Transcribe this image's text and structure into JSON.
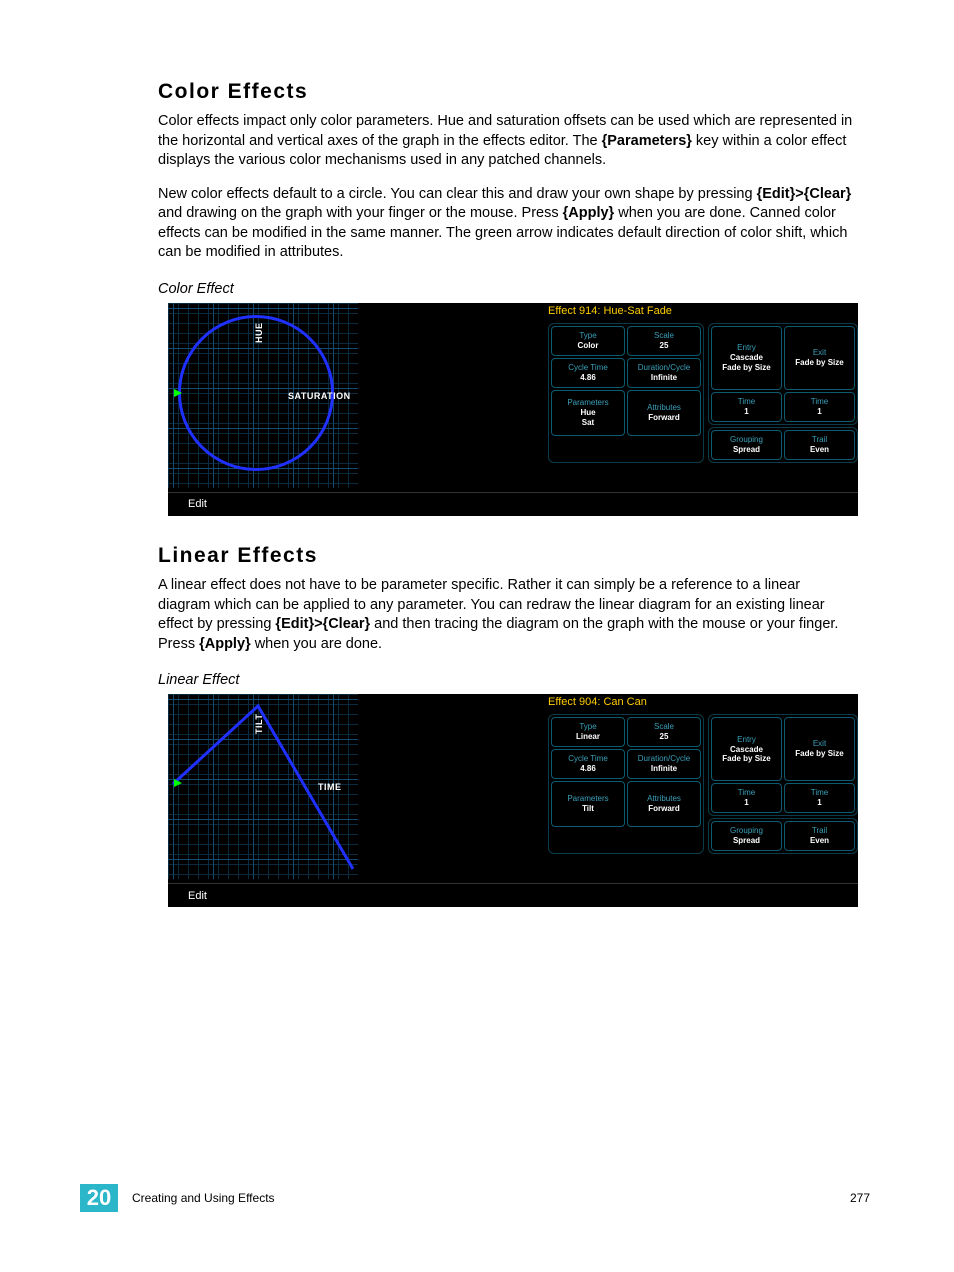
{
  "section1": {
    "heading": "Color Effects",
    "p1_a": "Color effects impact only color parameters. Hue and saturation offsets can be used which are represented in the horizontal and vertical axes of the graph in the effects editor. The ",
    "p1_b": "{Parameters}",
    "p1_c": " key within a color effect displays the various color mechanisms used in any patched channels.",
    "p2_a": "New color effects default to a circle. You can clear this and draw your own shape by pressing ",
    "p2_b": "{Edit}>{Clear}",
    "p2_c": " and drawing on the graph with your finger or the mouse. Press ",
    "p2_d": "{Apply}",
    "p2_e": " when you are done. Canned color effects can be modified in the same manner. The green arrow indicates default direction of color shift, which can be modified in attributes.",
    "caption": "Color Effect"
  },
  "panel1": {
    "title": "Effect 914: Hue-Sat Fade",
    "y_axis": "HUE",
    "x_axis": "SATURATION",
    "edit": "Edit",
    "left": {
      "type": {
        "label": "Type",
        "value": "Color"
      },
      "scale": {
        "label": "Scale",
        "value": "25"
      },
      "cycle": {
        "label": "Cycle Time",
        "value": "4.86"
      },
      "duration": {
        "label": "Duration/Cycle",
        "value": "Infinite"
      },
      "params": {
        "label": "Parameters",
        "value": "Hue\nSat"
      },
      "attrs": {
        "label": "Attributes",
        "value": "Forward"
      }
    },
    "right": {
      "entry": {
        "label": "Entry",
        "value": "Cascade\nFade by Size"
      },
      "exit": {
        "label": "Exit",
        "value": "Fade by Size"
      },
      "time1": {
        "label": "Time",
        "value": "1"
      },
      "time2": {
        "label": "Time",
        "value": "1"
      },
      "grouping": {
        "label": "Grouping",
        "value": "Spread"
      },
      "trail": {
        "label": "Trail",
        "value": "Even"
      }
    }
  },
  "section2": {
    "heading": "Linear Effects",
    "p1_a": "A linear effect does not have to be parameter specific. Rather it can simply be a reference to a linear diagram which can be applied to any parameter. You can redraw the linear diagram for an existing linear effect by pressing ",
    "p1_b": "{Edit}>{Clear}",
    "p1_c": " and then tracing the diagram on the graph with the mouse or your finger. Press ",
    "p1_d": "{Apply}",
    "p1_e": " when you are done.",
    "caption": "Linear Effect"
  },
  "panel2": {
    "title": "Effect 904: Can Can",
    "y_axis": "TILT",
    "x_axis": "TIME",
    "edit": "Edit",
    "left": {
      "type": {
        "label": "Type",
        "value": "Linear"
      },
      "scale": {
        "label": "Scale",
        "value": "25"
      },
      "cycle": {
        "label": "Cycle Time",
        "value": "4.86"
      },
      "duration": {
        "label": "Duration/Cycle",
        "value": "Infinite"
      },
      "params": {
        "label": "Parameters",
        "value": "Tilt"
      },
      "attrs": {
        "label": "Attributes",
        "value": "Forward"
      }
    },
    "right": {
      "entry": {
        "label": "Entry",
        "value": "Cascade\nFade by Size"
      },
      "exit": {
        "label": "Exit",
        "value": "Fade by Size"
      },
      "time1": {
        "label": "Time",
        "value": "1"
      },
      "time2": {
        "label": "Time",
        "value": "1"
      },
      "grouping": {
        "label": "Grouping",
        "value": "Spread"
      },
      "trail": {
        "label": "Trail",
        "value": "Even"
      }
    }
  },
  "footer": {
    "chapter": "20",
    "text": "Creating and Using Effects",
    "page": "277"
  }
}
